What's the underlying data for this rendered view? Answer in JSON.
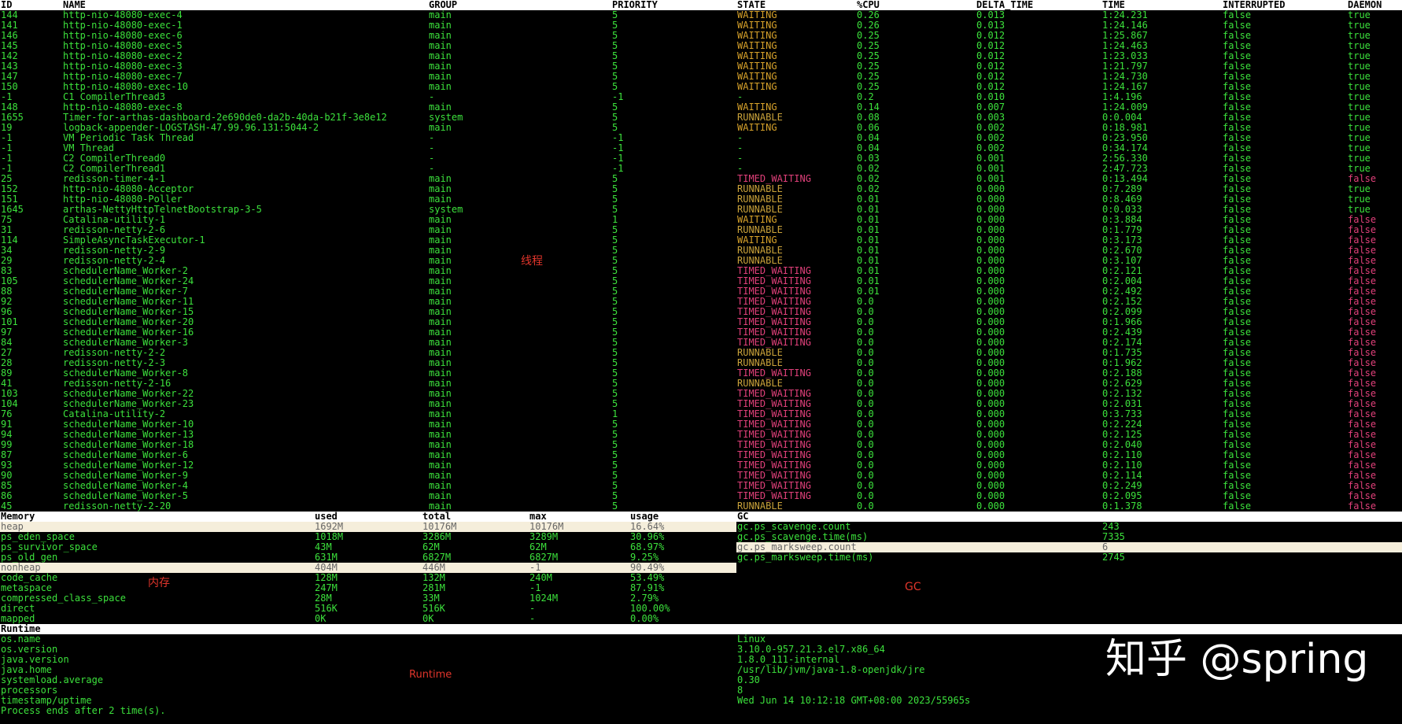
{
  "thread_table": {
    "headers": [
      "ID",
      "NAME",
      "GROUP",
      "PRIORITY",
      "STATE",
      "%CPU",
      "DELTA_TIME",
      "TIME",
      "INTERRUPTED",
      "DAEMON"
    ],
    "rows": [
      [
        "144",
        "http-nio-48080-exec-4",
        "main",
        "5",
        "WAITING",
        "0.26",
        "0.013",
        "1:24.231",
        "false",
        "true"
      ],
      [
        "141",
        "http-nio-48080-exec-1",
        "main",
        "5",
        "WAITING",
        "0.26",
        "0.013",
        "1:24.146",
        "false",
        "true"
      ],
      [
        "146",
        "http-nio-48080-exec-6",
        "main",
        "5",
        "WAITING",
        "0.25",
        "0.012",
        "1:25.867",
        "false",
        "true"
      ],
      [
        "145",
        "http-nio-48080-exec-5",
        "main",
        "5",
        "WAITING",
        "0.25",
        "0.012",
        "1:24.463",
        "false",
        "true"
      ],
      [
        "142",
        "http-nio-48080-exec-2",
        "main",
        "5",
        "WAITING",
        "0.25",
        "0.012",
        "1:23.033",
        "false",
        "true"
      ],
      [
        "143",
        "http-nio-48080-exec-3",
        "main",
        "5",
        "WAITING",
        "0.25",
        "0.012",
        "1:21.797",
        "false",
        "true"
      ],
      [
        "147",
        "http-nio-48080-exec-7",
        "main",
        "5",
        "WAITING",
        "0.25",
        "0.012",
        "1:24.730",
        "false",
        "true"
      ],
      [
        "150",
        "http-nio-48080-exec-10",
        "main",
        "5",
        "WAITING",
        "0.25",
        "0.012",
        "1:24.167",
        "false",
        "true"
      ],
      [
        "-1",
        "C1 CompilerThread3",
        "-",
        "-1",
        "-",
        "0.2",
        "0.010",
        "1:4.196",
        "false",
        "true"
      ],
      [
        "148",
        "http-nio-48080-exec-8",
        "main",
        "5",
        "WAITING",
        "0.14",
        "0.007",
        "1:24.009",
        "false",
        "true"
      ],
      [
        "1655",
        "Timer-for-arthas-dashboard-2e690de0-da2b-40da-b21f-3e8e12",
        "system",
        "5",
        "RUNNABLE",
        "0.08",
        "0.003",
        "0:0.004",
        "false",
        "true"
      ],
      [
        "19",
        "logback-appender-LOGSTASH-47.99.96.131:5044-2",
        "main",
        "5",
        "WAITING",
        "0.06",
        "0.002",
        "0:18.981",
        "false",
        "true"
      ],
      [
        "-1",
        "VM Periodic Task Thread",
        "-",
        "-1",
        "-",
        "0.04",
        "0.002",
        "0:23.950",
        "false",
        "true"
      ],
      [
        "-1",
        "VM Thread",
        "-",
        "-1",
        "-",
        "0.04",
        "0.002",
        "0:34.174",
        "false",
        "true"
      ],
      [
        "-1",
        "C2 CompilerThread0",
        "-",
        "-1",
        "-",
        "0.03",
        "0.001",
        "2:56.330",
        "false",
        "true"
      ],
      [
        "-1",
        "C2 CompilerThread1",
        "-",
        "-1",
        "-",
        "0.02",
        "0.001",
        "2:47.723",
        "false",
        "true"
      ],
      [
        "25",
        "redisson-timer-4-1",
        "main",
        "5",
        "TIMED_WAITING",
        "0.02",
        "0.001",
        "0:13.494",
        "false",
        "false"
      ],
      [
        "152",
        "http-nio-48080-Acceptor",
        "main",
        "5",
        "RUNNABLE",
        "0.02",
        "0.000",
        "0:7.289",
        "false",
        "true"
      ],
      [
        "151",
        "http-nio-48080-Poller",
        "main",
        "5",
        "RUNNABLE",
        "0.01",
        "0.000",
        "0:8.469",
        "false",
        "true"
      ],
      [
        "1645",
        "arthas-NettyHttpTelnetBootstrap-3-5",
        "system",
        "5",
        "RUNNABLE",
        "0.01",
        "0.000",
        "0:0.033",
        "false",
        "true"
      ],
      [
        "75",
        "Catalina-utility-1",
        "main",
        "1",
        "WAITING",
        "0.01",
        "0.000",
        "0:3.884",
        "false",
        "false"
      ],
      [
        "31",
        "redisson-netty-2-6",
        "main",
        "5",
        "RUNNABLE",
        "0.01",
        "0.000",
        "0:1.779",
        "false",
        "false"
      ],
      [
        "114",
        "SimpleAsyncTaskExecutor-1",
        "main",
        "5",
        "WAITING",
        "0.01",
        "0.000",
        "0:3.173",
        "false",
        "false"
      ],
      [
        "34",
        "redisson-netty-2-9",
        "main",
        "5",
        "RUNNABLE",
        "0.01",
        "0.000",
        "0:2.670",
        "false",
        "false"
      ],
      [
        "29",
        "redisson-netty-2-4",
        "main",
        "5",
        "RUNNABLE",
        "0.01",
        "0.000",
        "0:3.107",
        "false",
        "false"
      ],
      [
        "83",
        "schedulerName_Worker-2",
        "main",
        "5",
        "TIMED_WAITING",
        "0.01",
        "0.000",
        "0:2.121",
        "false",
        "false"
      ],
      [
        "105",
        "schedulerName_Worker-24",
        "main",
        "5",
        "TIMED_WAITING",
        "0.01",
        "0.000",
        "0:2.004",
        "false",
        "false"
      ],
      [
        "88",
        "schedulerName_Worker-7",
        "main",
        "5",
        "TIMED_WAITING",
        "0.01",
        "0.000",
        "0:2.492",
        "false",
        "false"
      ],
      [
        "92",
        "schedulerName_Worker-11",
        "main",
        "5",
        "TIMED_WAITING",
        "0.0",
        "0.000",
        "0:2.152",
        "false",
        "false"
      ],
      [
        "96",
        "schedulerName_Worker-15",
        "main",
        "5",
        "TIMED_WAITING",
        "0.0",
        "0.000",
        "0:2.099",
        "false",
        "false"
      ],
      [
        "101",
        "schedulerName_Worker-20",
        "main",
        "5",
        "TIMED_WAITING",
        "0.0",
        "0.000",
        "0:1.966",
        "false",
        "false"
      ],
      [
        "97",
        "schedulerName_Worker-16",
        "main",
        "5",
        "TIMED_WAITING",
        "0.0",
        "0.000",
        "0:2.439",
        "false",
        "false"
      ],
      [
        "84",
        "schedulerName_Worker-3",
        "main",
        "5",
        "TIMED_WAITING",
        "0.0",
        "0.000",
        "0:2.174",
        "false",
        "false"
      ],
      [
        "27",
        "redisson-netty-2-2",
        "main",
        "5",
        "RUNNABLE",
        "0.0",
        "0.000",
        "0:1.735",
        "false",
        "false"
      ],
      [
        "28",
        "redisson-netty-2-3",
        "main",
        "5",
        "RUNNABLE",
        "0.0",
        "0.000",
        "0:1.962",
        "false",
        "false"
      ],
      [
        "89",
        "schedulerName_Worker-8",
        "main",
        "5",
        "TIMED_WAITING",
        "0.0",
        "0.000",
        "0:2.188",
        "false",
        "false"
      ],
      [
        "41",
        "redisson-netty-2-16",
        "main",
        "5",
        "RUNNABLE",
        "0.0",
        "0.000",
        "0:2.629",
        "false",
        "false"
      ],
      [
        "103",
        "schedulerName_Worker-22",
        "main",
        "5",
        "TIMED_WAITING",
        "0.0",
        "0.000",
        "0:2.132",
        "false",
        "false"
      ],
      [
        "104",
        "schedulerName_Worker-23",
        "main",
        "5",
        "TIMED_WAITING",
        "0.0",
        "0.000",
        "0:2.031",
        "false",
        "false"
      ],
      [
        "76",
        "Catalina-utility-2",
        "main",
        "1",
        "TIMED_WAITING",
        "0.0",
        "0.000",
        "0:3.733",
        "false",
        "false"
      ],
      [
        "91",
        "schedulerName_Worker-10",
        "main",
        "5",
        "TIMED_WAITING",
        "0.0",
        "0.000",
        "0:2.224",
        "false",
        "false"
      ],
      [
        "94",
        "schedulerName_Worker-13",
        "main",
        "5",
        "TIMED_WAITING",
        "0.0",
        "0.000",
        "0:2.125",
        "false",
        "false"
      ],
      [
        "99",
        "schedulerName_Worker-18",
        "main",
        "5",
        "TIMED_WAITING",
        "0.0",
        "0.000",
        "0:2.040",
        "false",
        "false"
      ],
      [
        "87",
        "schedulerName_Worker-6",
        "main",
        "5",
        "TIMED_WAITING",
        "0.0",
        "0.000",
        "0:2.110",
        "false",
        "false"
      ],
      [
        "93",
        "schedulerName_Worker-12",
        "main",
        "5",
        "TIMED_WAITING",
        "0.0",
        "0.000",
        "0:2.110",
        "false",
        "false"
      ],
      [
        "90",
        "schedulerName_Worker-9",
        "main",
        "5",
        "TIMED_WAITING",
        "0.0",
        "0.000",
        "0:2.114",
        "false",
        "false"
      ],
      [
        "85",
        "schedulerName_Worker-4",
        "main",
        "5",
        "TIMED_WAITING",
        "0.0",
        "0.000",
        "0:2.249",
        "false",
        "false"
      ],
      [
        "86",
        "schedulerName_Worker-5",
        "main",
        "5",
        "TIMED_WAITING",
        "0.0",
        "0.000",
        "0:2.095",
        "false",
        "false"
      ],
      [
        "45",
        "redisson-netty-2-20",
        "main",
        "5",
        "RUNNABLE",
        "0.0",
        "0.000",
        "0:1.378",
        "false",
        "false"
      ]
    ]
  },
  "memory": {
    "headers": [
      "Memory",
      "used",
      "total",
      "max",
      "usage"
    ],
    "rows": [
      [
        "heap",
        "1692M",
        "10176M",
        "10176M",
        "16.64%"
      ],
      [
        "ps_eden_space",
        "1018M",
        "3286M",
        "3289M",
        "30.96%"
      ],
      [
        "ps_survivor_space",
        "43M",
        "62M",
        "62M",
        "68.97%"
      ],
      [
        "ps_old_gen",
        "631M",
        "6827M",
        "6827M",
        "9.25%"
      ],
      [
        "nonheap",
        "404M",
        "446M",
        "-1",
        "90.49%"
      ],
      [
        "code_cache",
        "128M",
        "132M",
        "240M",
        "53.49%"
      ],
      [
        "metaspace",
        "247M",
        "281M",
        "-1",
        "87.91%"
      ],
      [
        "compressed_class_space",
        "28M",
        "33M",
        "1024M",
        "2.79%"
      ],
      [
        "direct",
        "516K",
        "516K",
        "-",
        "100.00%"
      ],
      [
        "mapped",
        "0K",
        "0K",
        "-",
        "0.00%"
      ]
    ],
    "highlighted": [
      0,
      4
    ]
  },
  "gc": {
    "header": "GC",
    "rows": [
      [
        "gc.ps_scavenge.count",
        "243"
      ],
      [
        "gc.ps_scavenge.time(ms)",
        "7335"
      ],
      [
        "gc.ps_marksweep.count",
        "6"
      ],
      [
        "gc.ps_marksweep.time(ms)",
        "2745"
      ]
    ],
    "highlighted": [
      2
    ]
  },
  "runtime": {
    "header": "Runtime",
    "rows": [
      [
        "os.name",
        "Linux"
      ],
      [
        "os.version",
        "3.10.0-957.21.3.el7.x86_64"
      ],
      [
        "java.version",
        "1.8.0_111-internal"
      ],
      [
        "java.home",
        "/usr/lib/jvm/java-1.8-openjdk/jre"
      ],
      [
        "systemload.average",
        "0.30"
      ],
      [
        "processors",
        "8"
      ],
      [
        "timestamp/uptime",
        "Wed Jun 14 10:12:18 GMT+08:00 2023/55965s"
      ]
    ],
    "footer": "Process ends after 2 time(s)."
  },
  "annotations": {
    "threads": "线程",
    "memory": "内存",
    "gc": "GC",
    "runtime": "Runtime"
  },
  "watermark": "知乎 @spring",
  "colors": {
    "background": "#000000",
    "text_green": "#3ce13c",
    "waiting": "#d6a12a",
    "timed_waiting": "#e0407a",
    "runnable": "#c9a23a",
    "header_bg": "#ffffff",
    "highlight_bg": "#f5eedb",
    "annotation_red": "#e0352b"
  }
}
